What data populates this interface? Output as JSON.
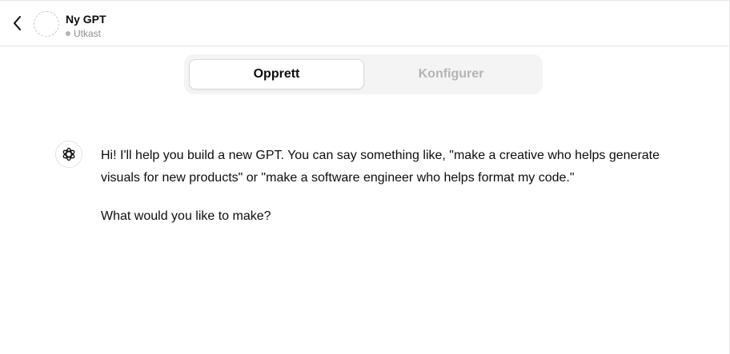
{
  "header": {
    "title": "Ny GPT",
    "status": "Utkast",
    "back_icon": "chevron-left-icon",
    "avatar_icon": "dashed-circle-placeholder"
  },
  "tabs": [
    {
      "label": "Opprett",
      "active": true
    },
    {
      "label": "Konfigurer",
      "active": false
    }
  ],
  "conversation": {
    "assistant_icon": "openai-logo-icon",
    "messages": [
      "Hi! I'll help you build a new GPT. You can say something like, \"make a creative who helps generate visuals for new products\" or \"make a software engineer who helps format my code.\"",
      "What would you like to make?"
    ]
  },
  "colors": {
    "border": "#e5e5e5",
    "tab_bg": "#f4f4f4",
    "inactive_text": "#b4b4b4",
    "text": "#0d0d0d"
  }
}
